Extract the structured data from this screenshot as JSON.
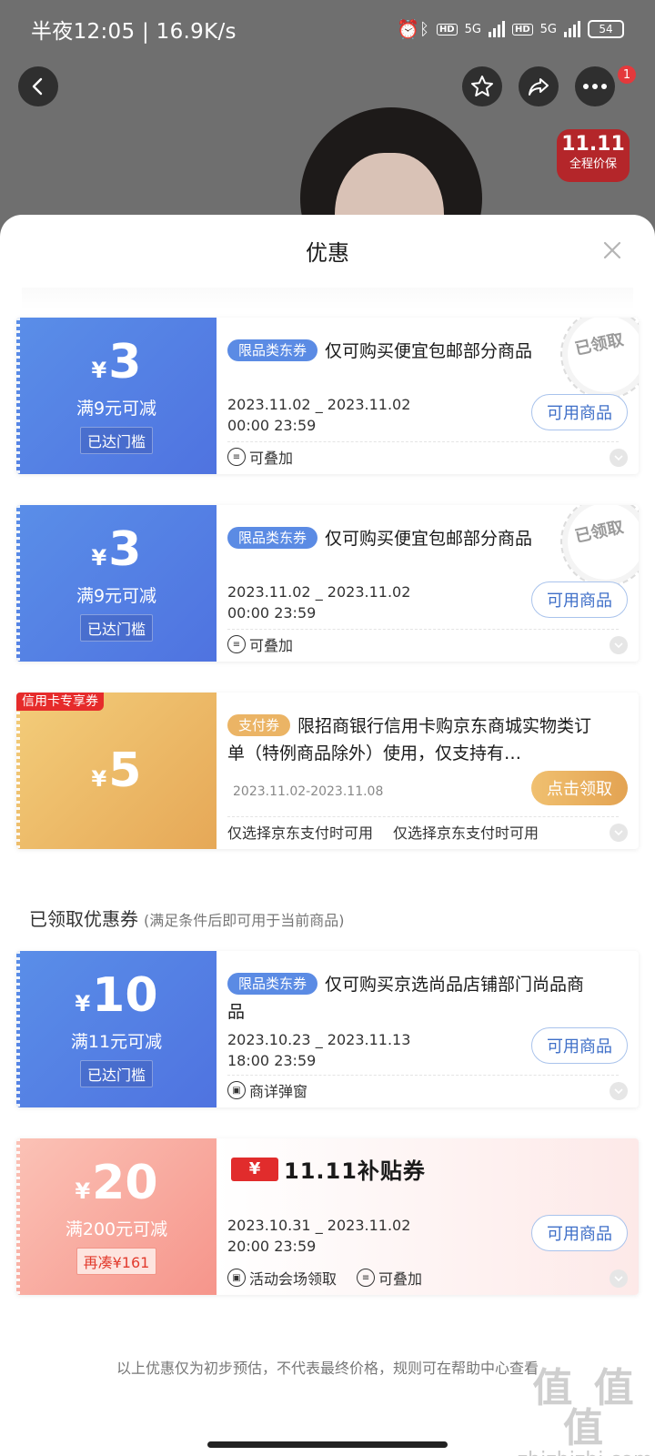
{
  "status_bar": {
    "time_text": "半夜12:05 | 16.9K/s",
    "net_label": "5G",
    "hd_label": "HD",
    "battery": "54"
  },
  "product_header": {
    "menu_badge": "1",
    "promo_badge": {
      "line1": "11.11",
      "line2": "全程价保"
    }
  },
  "sheet": {
    "title": "优惠",
    "coupons": [
      {
        "currency": "¥",
        "amount": "3",
        "condition": "满9元可减",
        "threshold": "已达门槛",
        "tag": "限品类东券",
        "desc": "仅可购买便宜包邮部分商品",
        "date_range": "2023.11.02 _ 2023.11.02",
        "time_range": "00:00 23:59",
        "button": "可用商品",
        "footer": "可叠加",
        "stamp": "已领取"
      },
      {
        "currency": "¥",
        "amount": "3",
        "condition": "满9元可减",
        "threshold": "已达门槛",
        "tag": "限品类东券",
        "desc": "仅可购买便宜包邮部分商品",
        "date_range": "2023.11.02 _ 2023.11.02",
        "time_range": "00:00 23:59",
        "button": "可用商品",
        "footer": "可叠加",
        "stamp": "已领取"
      },
      {
        "ribbon": "信用卡专享券",
        "currency": "¥",
        "amount": "5",
        "tag": "支付券",
        "desc": "限招商银行信用卡购京东商城实物类订单（特例商品除外）使用，仅支持有…",
        "date_range": "2023.11.02-2023.11.08",
        "button": "点击领取",
        "footer_a": "仅选择京东支付时可用",
        "footer_b": "仅选择京东支付时可用"
      }
    ],
    "section": {
      "title": "已领取优惠券",
      "subtitle": "(满足条件后即可用于当前商品)"
    },
    "claimed": [
      {
        "currency": "¥",
        "amount": "10",
        "condition": "满11元可减",
        "threshold": "已达门槛",
        "tag": "限品类东券",
        "desc": "仅可购买京选尚品店铺部门尚品商品",
        "date_range": "2023.10.23 _ 2023.11.13",
        "time_range": "18:00 23:59",
        "button": "可用商品",
        "footer": "商详弹窗"
      },
      {
        "currency": "¥",
        "amount": "20",
        "condition": "满200元可减",
        "threshold": "再凑¥161",
        "title_badge": "¥",
        "title": "11.11补贴券",
        "date_range": "2023.10.31 _ 2023.11.02",
        "time_range": "20:00 23:59",
        "button": "可用商品",
        "footer_a": "活动会场领取",
        "footer_b": "可叠加"
      }
    ],
    "disclaimer": "以上优惠仅为初步预估，不代表最终价格，规则可在帮助中心查看",
    "watermark": {
      "big": "值 值 值",
      "small": "zhizhizhi.com"
    }
  }
}
